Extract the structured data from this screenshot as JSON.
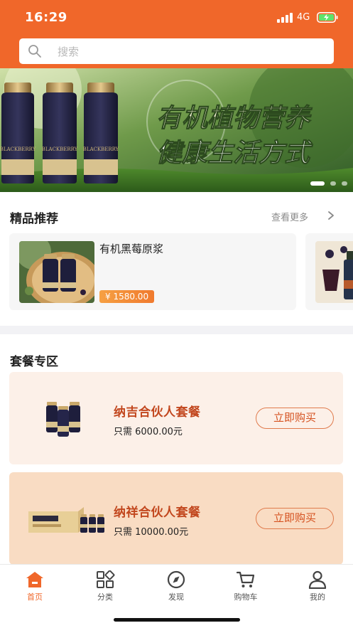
{
  "status_bar": {
    "time": "16:29",
    "network": "4G"
  },
  "search": {
    "placeholder": "搜索",
    "icon": "search-icon"
  },
  "banner": {
    "headline_line1": "有机植物营养",
    "headline_line2": "健康生活方式",
    "bottle_label": "BLACKBERRY",
    "page_count": 3,
    "active_page": 1
  },
  "featured": {
    "title": "精品推荐",
    "more_label": "查看更多",
    "products": [
      {
        "name": "有机黑莓原浆",
        "price": "¥ 1580.00"
      }
    ]
  },
  "packages": {
    "title": "套餐专区",
    "items": [
      {
        "name": "纳吉合伙人套餐",
        "price": "只需 6000.00元",
        "button": "立即购买",
        "bg": "#fcf0e8"
      },
      {
        "name": "纳祥合伙人套餐",
        "price": "只需 10000.00元",
        "button": "立即购买",
        "bg": "#f9dcc3"
      }
    ]
  },
  "tabbar": {
    "items": [
      {
        "label": "首页",
        "icon": "home-icon",
        "active": true
      },
      {
        "label": "分类",
        "icon": "category-icon"
      },
      {
        "label": "发现",
        "icon": "compass-icon"
      },
      {
        "label": "购物车",
        "icon": "cart-icon"
      },
      {
        "label": "我的",
        "icon": "user-icon"
      }
    ]
  },
  "colors": {
    "brand": "#f0672a",
    "accent_text": "#c2471e",
    "price_tag": "#f07a2e"
  }
}
